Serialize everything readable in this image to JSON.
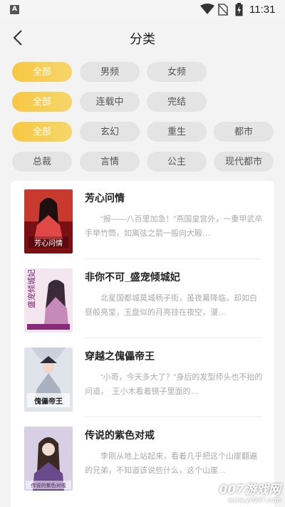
{
  "status_bar": {
    "app_icon_letter": "A",
    "time": "11:31"
  },
  "header": {
    "title": "分类"
  },
  "filters": {
    "row1": [
      {
        "label": "全部",
        "active": true
      },
      {
        "label": "男频",
        "active": false
      },
      {
        "label": "女频",
        "active": false
      }
    ],
    "row2": [
      {
        "label": "全部",
        "active": true
      },
      {
        "label": "连载中",
        "active": false
      },
      {
        "label": "完结",
        "active": false
      }
    ],
    "row3": [
      {
        "label": "全部",
        "active": true
      },
      {
        "label": "玄幻",
        "active": false
      },
      {
        "label": "重生",
        "active": false
      },
      {
        "label": "都市",
        "active": false
      }
    ],
    "row4": [
      {
        "label": "总裁",
        "active": false
      },
      {
        "label": "言情",
        "active": false
      },
      {
        "label": "公主",
        "active": false
      },
      {
        "label": "现代都市",
        "active": false
      }
    ]
  },
  "books": [
    {
      "title": "芳心问情",
      "desc": "“报——八百里加急！”燕国皇宫外，一重甲武卒手举竹筒，如离弦之箭一般向大殿…",
      "cover_text": "芳心问情"
    },
    {
      "title": "非你不可_盛宠倾城妃",
      "desc": "北星国都城莫城杨子街，虽夜幕降临，却如白昼般亮堂，玉盘似的月亮挂在夜空，漫…",
      "cover_text": "盛宠倾城妃"
    },
    {
      "title": "穿越之傀儡帝王",
      "desc": "“小哥，今天多大了？”身后的发型师头也不抬的问道。　王小木看着镜子里面的…",
      "cover_text": "傀儡帝王"
    },
    {
      "title": "传说的紫色对戒",
      "desc": "李刚从地上站起来，看着几乎把这个山崖翻遍的兄弟，不知道该说些什么，这个山崖…",
      "cover_text": "传说的紫色对戒"
    }
  ],
  "watermark": {
    "main": "007游戏网",
    "url": "www.yx007.com"
  },
  "colors": {
    "accent": "#f7c843",
    "chip_bg": "#e4e4e4",
    "background": "#f3f3f3"
  }
}
